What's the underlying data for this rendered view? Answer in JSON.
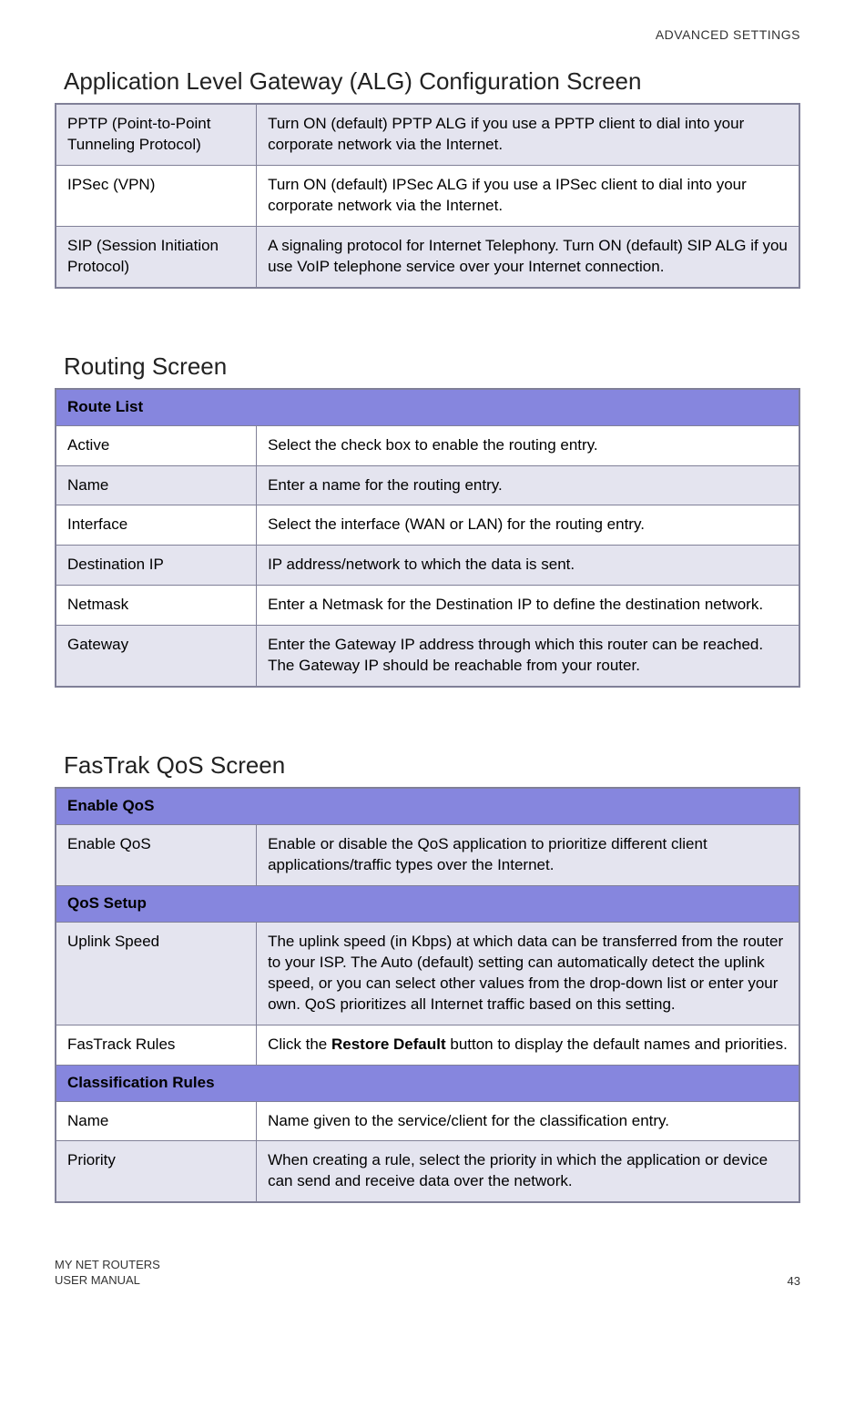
{
  "header": {
    "section_label": "ADVANCED SETTINGS"
  },
  "alg": {
    "title": "Application Level Gateway (ALG) Configuration Screen",
    "rows": [
      {
        "label": "PPTP (Point-to-Point Tunneling Protocol)",
        "desc": "Turn ON (default) PPTP ALG if you use a PPTP client to dial into your corporate network via the Internet."
      },
      {
        "label": "IPSec (VPN)",
        "desc": "Turn ON (default) IPSec ALG if you use a IPSec client to dial into your corporate network via the Internet."
      },
      {
        "label": "SIP (Session Initiation Protocol)",
        "desc": "A signaling protocol for Internet Telephony. Turn ON (default) SIP ALG if you use VoIP telephone service over your Internet connection."
      }
    ]
  },
  "routing": {
    "title": "Routing Screen",
    "header": "Route List",
    "rows": [
      {
        "label": "Active",
        "desc": "Select the check box to enable the routing entry."
      },
      {
        "label": "Name",
        "desc": "Enter a name for the routing entry."
      },
      {
        "label": "Interface",
        "desc": "Select the interface (WAN or LAN) for the routing entry."
      },
      {
        "label": "Destination IP",
        "desc": "IP address/network to which the data is sent."
      },
      {
        "label": "Netmask",
        "desc": "Enter a Netmask for the Destination IP to define the destination network."
      },
      {
        "label": "Gateway",
        "desc": "Enter the Gateway IP address through which this router can be reached. The Gateway IP should be reachable from your router."
      }
    ]
  },
  "qos": {
    "title": "FasTrak QoS Screen",
    "header_enable": "Enable QoS",
    "row_enable": {
      "label": "Enable QoS",
      "desc": "Enable or disable the QoS application to prioritize different client applications/traffic types over the Internet."
    },
    "header_setup": "QoS Setup",
    "row_uplink": {
      "label": "Uplink Speed",
      "desc": "The uplink speed (in Kbps) at which data can be transferred from the router to your ISP. The Auto (default) setting can automatically detect the uplink speed, or you can select other values from the drop-down list or enter your own. QoS prioritizes all Internet traffic based on this setting."
    },
    "row_rules": {
      "label": "FasTrack Rules",
      "desc_pre": "Click the ",
      "desc_bold": "Restore Default",
      "desc_post": " button to display the default names and priorities."
    },
    "header_class": "Classification Rules",
    "row_name": {
      "label": "Name",
      "desc": "Name given to the service/client for the classification entry."
    },
    "row_priority": {
      "label": "Priority",
      "desc": "When creating a rule, select the priority in which the application or device can send and receive data over the network."
    }
  },
  "footer": {
    "line1": "MY NET ROUTERS",
    "line2": "USER MANUAL",
    "page": "43"
  }
}
